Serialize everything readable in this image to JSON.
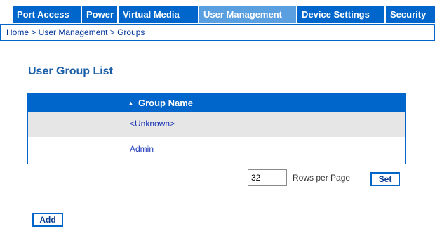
{
  "nav": {
    "tabs": [
      {
        "label": "Port Access",
        "active": false
      },
      {
        "label": "Power",
        "active": false
      },
      {
        "label": "Virtual Media",
        "active": false
      },
      {
        "label": "User Management",
        "active": true
      },
      {
        "label": "Device Settings",
        "active": false
      },
      {
        "label": "Security",
        "active": false
      }
    ]
  },
  "breadcrumb": "Home > User Management > Groups",
  "page_title": "User Group List",
  "table": {
    "column_header": "Group Name",
    "sort_icon": "▲",
    "rows": [
      {
        "name": "<Unknown>"
      },
      {
        "name": "Admin"
      }
    ]
  },
  "pagination": {
    "rows_value": "32",
    "rows_label": "Rows per Page",
    "set_label": "Set"
  },
  "actions": {
    "add_label": "Add"
  },
  "colors": {
    "tab_bg": "#0066cc",
    "active_tab_bg": "#5a9fe0",
    "link": "#1a35b5",
    "title": "#1a5fa8",
    "row_shade": "#e6e6e6"
  }
}
